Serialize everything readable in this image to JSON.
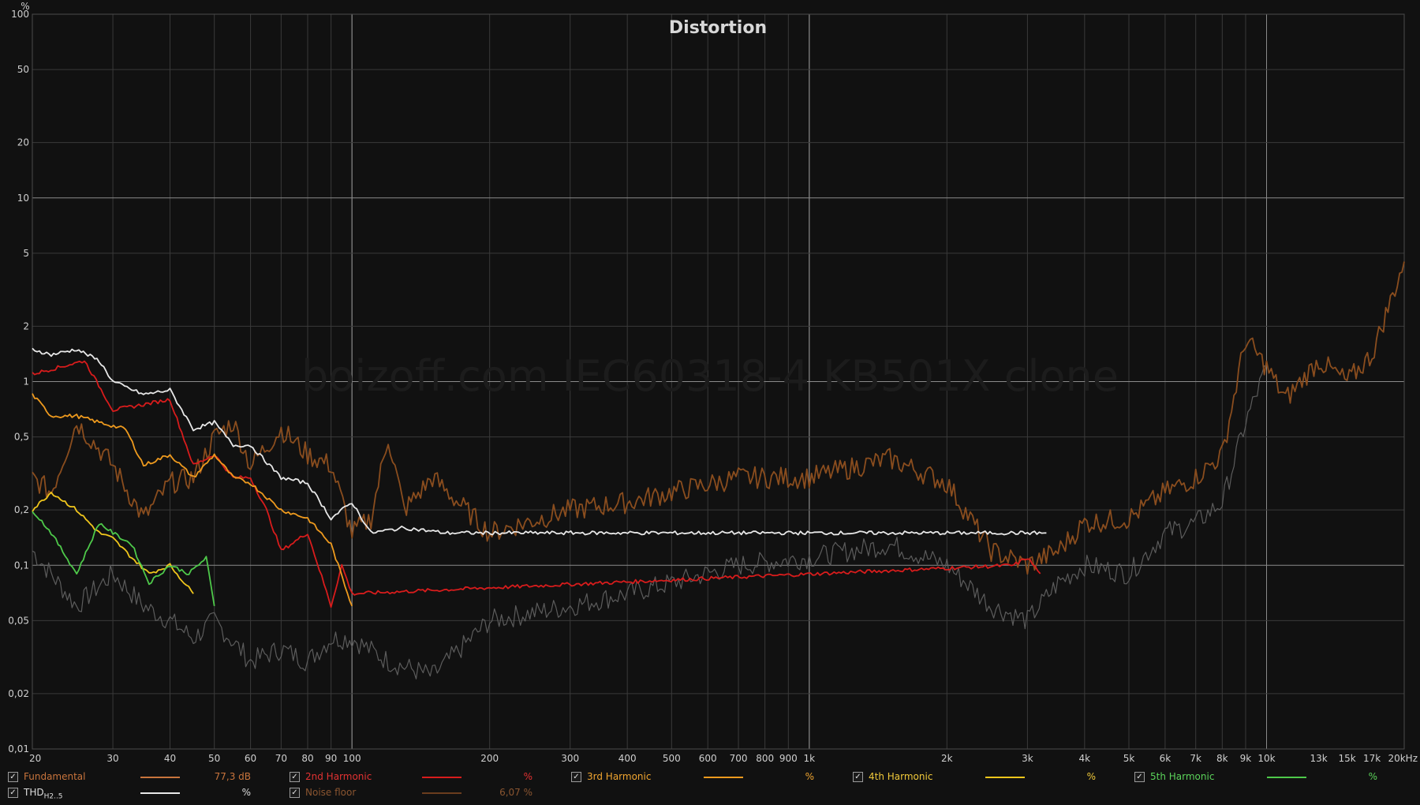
{
  "chart_data": {
    "type": "line",
    "title": "Distortion",
    "watermark": "boizoff.com IEC60318-4 KB501X clone",
    "y_unit": "%",
    "x_unit": "kHz",
    "x_scale": "log",
    "y_scale": "log",
    "xlim": [
      20,
      20000
    ],
    "ylim": [
      0.01,
      100
    ],
    "grid": true,
    "y_ticks": [
      {
        "v": 100,
        "label": "100"
      },
      {
        "v": 50,
        "label": "50"
      },
      {
        "v": 20,
        "label": "20"
      },
      {
        "v": 10,
        "label": "10"
      },
      {
        "v": 5,
        "label": "5"
      },
      {
        "v": 2,
        "label": "2"
      },
      {
        "v": 1,
        "label": "1"
      },
      {
        "v": 0.5,
        "label": "0,5"
      },
      {
        "v": 0.2,
        "label": "0,2"
      },
      {
        "v": 0.1,
        "label": "0,1"
      },
      {
        "v": 0.05,
        "label": "0,05"
      },
      {
        "v": 0.02,
        "label": "0,02"
      },
      {
        "v": 0.01,
        "label": "0,01"
      }
    ],
    "x_ticks": [
      {
        "v": 20,
        "label": "20"
      },
      {
        "v": 30,
        "label": "30"
      },
      {
        "v": 40,
        "label": "40"
      },
      {
        "v": 50,
        "label": "50"
      },
      {
        "v": 60,
        "label": "60"
      },
      {
        "v": 70,
        "label": "70"
      },
      {
        "v": 80,
        "label": "80"
      },
      {
        "v": 90,
        "label": "90"
      },
      {
        "v": 100,
        "label": "100"
      },
      {
        "v": 200,
        "label": "200"
      },
      {
        "v": 300,
        "label": "300"
      },
      {
        "v": 400,
        "label": "400"
      },
      {
        "v": 500,
        "label": "500"
      },
      {
        "v": 600,
        "label": "600"
      },
      {
        "v": 700,
        "label": "700"
      },
      {
        "v": 800,
        "label": "800"
      },
      {
        "v": 900,
        "label": "900"
      },
      {
        "v": 1000,
        "label": "1k"
      },
      {
        "v": 2000,
        "label": "2k"
      },
      {
        "v": 3000,
        "label": "3k"
      },
      {
        "v": 4000,
        "label": "4k"
      },
      {
        "v": 5000,
        "label": "5k"
      },
      {
        "v": 6000,
        "label": "6k"
      },
      {
        "v": 7000,
        "label": "7k"
      },
      {
        "v": 8000,
        "label": "8k"
      },
      {
        "v": 9000,
        "label": "9k"
      },
      {
        "v": 10000,
        "label": "10k"
      },
      {
        "v": 13000,
        "label": "13k"
      },
      {
        "v": 15000,
        "label": "15k"
      },
      {
        "v": 17000,
        "label": "17k"
      },
      {
        "v": 20000,
        "label": "20kHz"
      }
    ],
    "series": [
      {
        "name": "Noise floor",
        "color": "#5c5c5c",
        "x": [
          20,
          25,
          30,
          35,
          40,
          45,
          50,
          60,
          70,
          80,
          90,
          100,
          120,
          150,
          200,
          300,
          400,
          500,
          700,
          1000,
          1500,
          2000,
          2500,
          3000,
          3500,
          4000,
          5000,
          6000,
          7000,
          8000,
          9000,
          10000
        ],
        "y": [
          0.12,
          0.06,
          0.09,
          0.06,
          0.05,
          0.04,
          0.05,
          0.03,
          0.035,
          0.03,
          0.04,
          0.04,
          0.03,
          0.025,
          0.05,
          0.06,
          0.07,
          0.08,
          0.1,
          0.11,
          0.13,
          0.1,
          0.06,
          0.05,
          0.08,
          0.1,
          0.09,
          0.15,
          0.17,
          0.22,
          0.6,
          1.2
        ]
      },
      {
        "name": "Fundamental",
        "color": "#8a4d1e",
        "x": [
          20,
          22,
          25,
          30,
          35,
          40,
          45,
          50,
          55,
          60,
          70,
          80,
          90,
          100,
          110,
          120,
          130,
          150,
          200,
          300,
          400,
          500,
          700,
          1000,
          1500,
          2000,
          2500,
          3000,
          3500,
          4000,
          5000,
          6000,
          7000,
          8000,
          9000,
          10000,
          11000,
          13000,
          15000,
          17000,
          20000
        ],
        "y": [
          0.3,
          0.25,
          0.6,
          0.35,
          0.18,
          0.28,
          0.3,
          0.5,
          0.6,
          0.35,
          0.55,
          0.4,
          0.35,
          0.15,
          0.18,
          0.5,
          0.2,
          0.3,
          0.15,
          0.2,
          0.22,
          0.25,
          0.3,
          0.3,
          0.38,
          0.28,
          0.12,
          0.1,
          0.12,
          0.17,
          0.18,
          0.25,
          0.3,
          0.4,
          1.7,
          1.2,
          0.8,
          1.3,
          1.0,
          1.4,
          4.5
        ]
      },
      {
        "name": "2nd Harmonic",
        "color": "#d81c1c",
        "x": [
          20,
          23,
          26,
          30,
          35,
          40,
          45,
          50,
          55,
          60,
          65,
          70,
          80,
          90,
          95,
          100,
          2800,
          3000,
          3200
        ],
        "y": [
          1.1,
          1.2,
          1.3,
          0.7,
          0.75,
          0.8,
          0.35,
          0.4,
          0.3,
          0.3,
          0.2,
          0.12,
          0.15,
          0.06,
          0.1,
          0.07,
          0.1,
          0.11,
          0.09
        ]
      },
      {
        "name": "3rd Harmonic",
        "color": "#ee9a1e",
        "x": [
          20,
          22,
          25,
          28,
          32,
          35,
          40,
          45,
          50,
          55,
          60,
          70,
          80,
          90,
          100
        ],
        "y": [
          0.85,
          0.65,
          0.65,
          0.6,
          0.55,
          0.35,
          0.4,
          0.3,
          0.4,
          0.3,
          0.28,
          0.2,
          0.18,
          0.13,
          0.06
        ]
      },
      {
        "name": "4th Harmonic",
        "color": "#f0c61c",
        "x": [
          20,
          22,
          25,
          28,
          30,
          33,
          36,
          40,
          45
        ],
        "y": [
          0.2,
          0.25,
          0.2,
          0.15,
          0.14,
          0.11,
          0.09,
          0.1,
          0.07
        ]
      },
      {
        "name": "5th Harmonic",
        "color": "#4ec94a",
        "x": [
          20,
          22,
          25,
          28,
          30,
          33,
          36,
          40,
          44,
          48,
          50
        ],
        "y": [
          0.2,
          0.15,
          0.09,
          0.17,
          0.15,
          0.13,
          0.08,
          0.1,
          0.09,
          0.11,
          0.06
        ]
      },
      {
        "name": "THD",
        "color": "#e8e8e8",
        "x": [
          20,
          22,
          25,
          28,
          30,
          35,
          40,
          45,
          50,
          55,
          60,
          70,
          80,
          90,
          100,
          110,
          130,
          160,
          2700,
          3000,
          3300
        ],
        "y": [
          1.5,
          1.4,
          1.5,
          1.3,
          1.0,
          0.85,
          0.9,
          0.55,
          0.6,
          0.45,
          0.45,
          0.3,
          0.28,
          0.18,
          0.22,
          0.15,
          0.16,
          0.15,
          0.15,
          0.15,
          0.15
        ]
      }
    ]
  },
  "legend": {
    "row1": [
      {
        "label": "Fundamental",
        "color": "#c8743c",
        "value": "77,3 dB",
        "value_color": "#c8743c",
        "line": "#c8743c"
      },
      {
        "label": "2nd Harmonic",
        "color": "#e23232",
        "value": "%",
        "value_color": "#e23232",
        "line": "#d81c1c"
      },
      {
        "label": "3rd Harmonic",
        "color": "#f0a530",
        "value": "%",
        "value_color": "#f0a530",
        "line": "#ee9a1e"
      },
      {
        "label": "4th Harmonic",
        "color": "#f0c93a",
        "value": "%",
        "value_color": "#f0c93a",
        "line": "#f0c61c"
      },
      {
        "label": "5th Harmonic",
        "color": "#5bd35a",
        "value": "%",
        "value_color": "#5bd35a",
        "line": "#4ec94a"
      }
    ],
    "row2": [
      {
        "label": "THD",
        "sub": "H2..5",
        "color": "#dddddd",
        "value": "%",
        "value_color": "#dddddd",
        "line": "#e8e8e8"
      },
      {
        "label": "Noise floor",
        "color": "#8a5530",
        "value": "6,07 %",
        "value_color": "#8a5530",
        "line": "#6a3d1e"
      }
    ],
    "check_mark": "✓"
  }
}
